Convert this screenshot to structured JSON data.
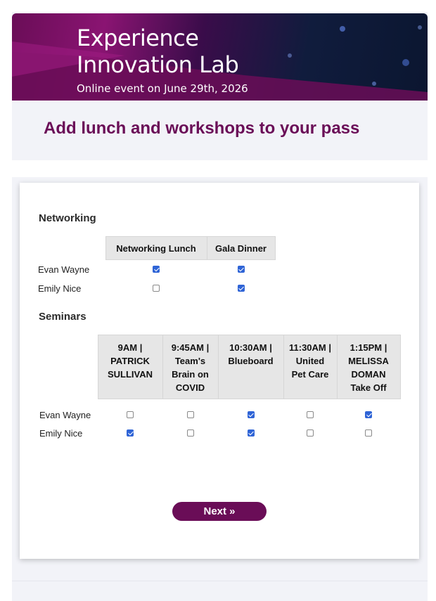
{
  "banner": {
    "title_line1": "Experience",
    "title_line2": "Innovation Lab",
    "subtitle": "Online event on June 29th, 2026"
  },
  "heading": "Add lunch and workshops to your pass",
  "networking": {
    "title": "Networking",
    "columns": [
      "Networking Lunch",
      "Gala Dinner"
    ],
    "rows": [
      {
        "name": "Evan Wayne",
        "checked": [
          true,
          true
        ]
      },
      {
        "name": "Emily Nice",
        "checked": [
          false,
          true
        ]
      }
    ]
  },
  "seminars": {
    "title": "Seminars",
    "columns": [
      [
        "9AM |",
        "PATRICK",
        "SULLIVAN"
      ],
      [
        "9:45AM |",
        "Team's",
        "Brain on",
        "COVID"
      ],
      [
        "10:30AM |",
        "Blueboard"
      ],
      [
        "11:30AM |",
        "United",
        "Pet Care"
      ],
      [
        "1:15PM |",
        "MELISSA",
        "DOMAN",
        "Take Off"
      ]
    ],
    "rows": [
      {
        "name": "Evan Wayne",
        "checked": [
          false,
          false,
          true,
          false,
          true
        ]
      },
      {
        "name": "Emily Nice",
        "checked": [
          true,
          false,
          true,
          false,
          false
        ]
      }
    ]
  },
  "next_button": "Next »",
  "colors": {
    "brand": "#6a0d57",
    "checkbox": "#2f64d6"
  }
}
